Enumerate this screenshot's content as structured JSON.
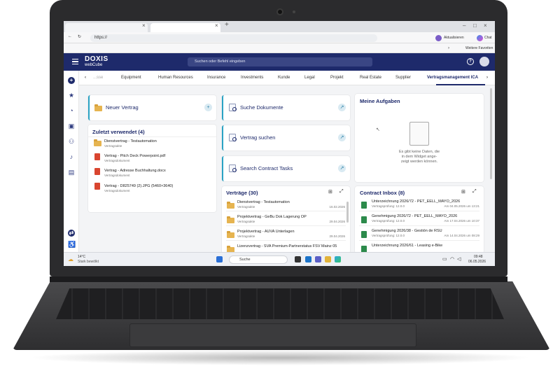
{
  "browser": {
    "url": "https://",
    "update_label": "Aktualisieren",
    "chat_label": "Chat",
    "favorites_label": "Weitere Favoriten"
  },
  "app": {
    "logo_top": "DOXIS",
    "logo_bottom": "webCube",
    "search_placeholder": "Suchen oder Befehl eingeben"
  },
  "categories": [
    "Equipment",
    "Human Resources",
    "Insurance",
    "Investments",
    "Kunde",
    "Legal",
    "Projekt",
    "Real Estate",
    "Supplier",
    "Vertragsmanagement ICA"
  ],
  "categories_partial": "...sse",
  "cards": {
    "new_contract": "Neuer Vertrag",
    "search_docs": "Suche Dokumente",
    "search_contract": "Vertrag suchen",
    "search_tasks": "Search Contract Tasks",
    "my_tasks": "Meine Aufgaben",
    "empty_text_1": "Es gibt keine Daten, die",
    "empty_text_2": "in dem Widget ange-",
    "empty_text_3": "zeigt werden können.",
    "recent_title": "Zuletzt verwendet (4)",
    "contracts_title": "Verträge (30)",
    "inbox_title": "Contract Inbox (8)"
  },
  "recent_items": [
    {
      "title": "Dienstvertrag - Testautomation",
      "sub": "Vertragsakte",
      "type": "folder"
    },
    {
      "title": "Vertrag - Pitch Deck Powerpoint.pdf",
      "sub": "Vertragsdokument",
      "type": "doc"
    },
    {
      "title": "Vertrag - Adresse Buchhaltung.docx",
      "sub": "Vertragsdokument",
      "type": "doc"
    },
    {
      "title": "Vertrag - D825749 (2).JPG (5460×3640)",
      "sub": "Vertragsdokument",
      "type": "doc"
    }
  ],
  "contracts": [
    {
      "title": "Dienstvertrag - Testautomation",
      "sub": "Vertragsakte",
      "date": "16.02.2026"
    },
    {
      "title": "Projektvertrag - GeBu Dok Lagerung OP",
      "sub": "Vertragsakte",
      "date": "29.04.2026"
    },
    {
      "title": "Projektvertrag - AUVA Unterlagen",
      "sub": "Vertragsakte",
      "date": "29.04.2026"
    },
    {
      "title": "Lizenzvertrag - SVA Premium-Partnerstatus FSV Mainz 05",
      "sub": "",
      "date": ""
    }
  ],
  "inbox": [
    {
      "title": "Unterzeichnung 2026/72 - PET_EELL_MAYO_2026",
      "sub": "Vertragsprüfung: 12.0.0",
      "date": "Am 04.05.2026 um 13:21"
    },
    {
      "title": "Genehmigung 2026/72 - PET_EELL_MAYO_2026",
      "sub": "Vertragsprüfung: 12.0.0",
      "date": "Am 17.04.2026 um 10:37"
    },
    {
      "title": "Genehmigung 2026/38 - Gestión de RSU",
      "sub": "Vertragsprüfung: 12.0.0",
      "date": "Am 14.04.2026 um 08:29"
    },
    {
      "title": "Unterzeichnung 2026/61 - Leasing e-Bike",
      "sub": "",
      "date": ""
    }
  ],
  "taskbar": {
    "weather_temp": "14°C",
    "weather_desc": "Stark bewölkt",
    "search_label": "Suche",
    "time": "09:48",
    "date": "06.05.2026"
  }
}
